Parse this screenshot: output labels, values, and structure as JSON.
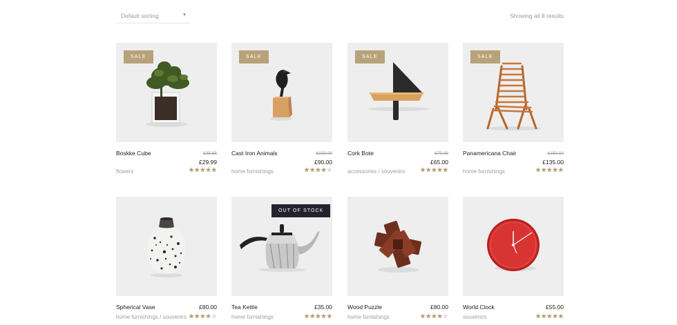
{
  "sorting": {
    "selected": "Default sorting"
  },
  "result_count": "Showing all 8 results",
  "colors": {
    "sale_badge": "#b8a27a",
    "oos_badge": "#23232f",
    "star_filled": "#b8a27a",
    "star_empty": "#dddddd",
    "thumb_bg": "#eeeeee"
  },
  "products": [
    {
      "name": "Boskke Cube",
      "badge": "SALE",
      "old_price": "£35.55",
      "price": "£29.99",
      "categories": "flowers",
      "rating": 5,
      "image_icon": "potted-plant-icon"
    },
    {
      "name": "Cast Iron Animals",
      "badge": "SALE",
      "old_price": "£100.00",
      "price": "£90.00",
      "categories": "home furnishings",
      "rating": 4,
      "image_icon": "bird-figurine-icon"
    },
    {
      "name": "Cork Bote",
      "badge": "SALE",
      "old_price": "£70.00",
      "price": "£65.00",
      "categories": "accessories / souvenirs",
      "rating": 5,
      "image_icon": "cork-boat-icon"
    },
    {
      "name": "Panamericana Chair",
      "badge": "SALE",
      "old_price": "£150.00",
      "price": "£135.00",
      "categories": "home furnishings",
      "rating": 5,
      "image_icon": "wooden-chair-icon"
    },
    {
      "name": "Spherical Vase",
      "badge": "",
      "old_price": "",
      "price": "£80.00",
      "categories": "home furnishings / souvenirs",
      "rating": 4,
      "image_icon": "speckled-vase-icon"
    },
    {
      "name": "Tea Kettle",
      "badge": "OUT OF STOCK",
      "old_price": "",
      "price": "£35.00",
      "categories": "home furnishings",
      "rating": 5,
      "image_icon": "kettle-icon"
    },
    {
      "name": "Wood Puzzle",
      "badge": "",
      "old_price": "",
      "price": "£80.00",
      "categories": "home furnishings",
      "rating": 4,
      "image_icon": "wood-puzzle-icon"
    },
    {
      "name": "World Clock",
      "badge": "",
      "old_price": "",
      "price": "£55.00",
      "categories": "souvenirs",
      "rating": 5,
      "image_icon": "clock-icon"
    }
  ]
}
